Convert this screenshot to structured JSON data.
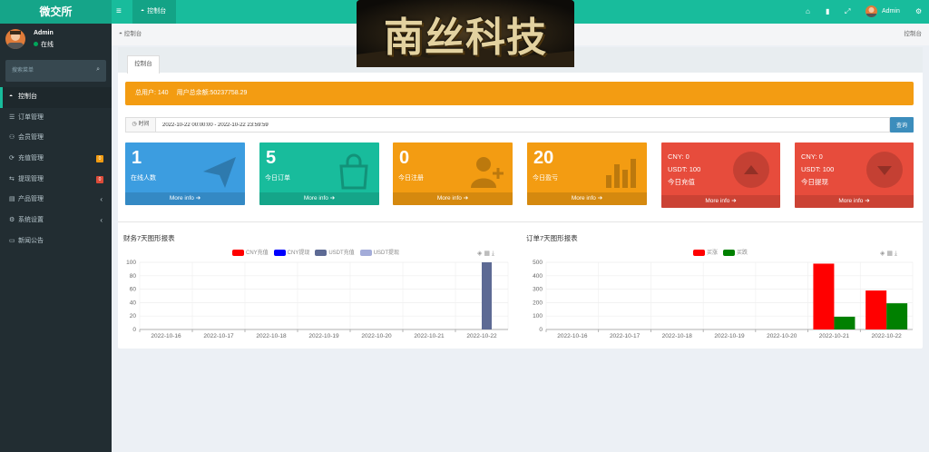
{
  "app": {
    "brand": "微交所",
    "top_tab": "控制台",
    "user": "Admin",
    "logo_text": "南丝科技"
  },
  "sidebar": {
    "name": "Admin",
    "status": "在线",
    "search_placeholder": "搜索菜单",
    "items": [
      {
        "label": "控制台",
        "icon": "dashboard-icon",
        "active": true
      },
      {
        "label": "订单管理",
        "icon": "list-icon"
      },
      {
        "label": "会员管理",
        "icon": "users-icon"
      },
      {
        "label": "充值管理",
        "icon": "recharge-icon",
        "badge": "0",
        "badge_color": "#f39c12"
      },
      {
        "label": "提现管理",
        "icon": "withdraw-icon",
        "badge": "0",
        "badge_color": "#dd4b39"
      },
      {
        "label": "产品管理",
        "icon": "product-icon",
        "arrow": "‹"
      },
      {
        "label": "系统设置",
        "icon": "cogs-icon",
        "arrow": "‹"
      },
      {
        "label": "新闻公告",
        "icon": "news-icon"
      }
    ]
  },
  "breadcrumb": {
    "left": "控制台",
    "right": "控制台"
  },
  "tab": {
    "label": "控制台"
  },
  "alert": {
    "users": "总用户: 140",
    "balance": "用户总余额:50237758.29"
  },
  "date_filter": {
    "label": "时间",
    "value": "2022-10-22 00:00:00 - 2022-10-22 23:59:59",
    "button": "查询"
  },
  "stats": [
    {
      "value": "1",
      "label": "在线人数",
      "footer": "More info ➔",
      "color": "#3c9de0"
    },
    {
      "value": "5",
      "label": "今日订单",
      "footer": "More info ➔",
      "color": "#18bc9c"
    },
    {
      "value": "0",
      "label": "今日注册",
      "footer": "More info ➔",
      "color": "#f39c12"
    },
    {
      "value": "20",
      "label": "今日盈亏",
      "footer": "More info ➔",
      "color": "#f39c12"
    },
    {
      "line1": "CNY:  0",
      "line2": "USDT:  100",
      "label": "今日充值",
      "footer": "More info ➔",
      "color": "#e74c3c"
    },
    {
      "line1": "CNY:  0",
      "line2": "USDT:  100",
      "label": "今日提现",
      "footer": "More info ➔",
      "color": "#e74c3c"
    }
  ],
  "chart_data": [
    {
      "type": "bar",
      "title": "财务7天图形报表",
      "categories": [
        "2022-10-16",
        "2022-10-17",
        "2022-10-18",
        "2022-10-19",
        "2022-10-20",
        "2022-10-21",
        "2022-10-22"
      ],
      "ylim": [
        0,
        100
      ],
      "yticks": [
        0,
        20,
        40,
        60,
        80,
        100
      ],
      "series": [
        {
          "name": "CNY充值",
          "color": "#ff0000",
          "values": [
            0,
            0,
            0,
            0,
            0,
            0,
            0
          ]
        },
        {
          "name": "CNY提现",
          "color": "#0000ff",
          "values": [
            0,
            0,
            0,
            0,
            0,
            0,
            0
          ]
        },
        {
          "name": "USDT充值",
          "color": "#5d6a94",
          "values": [
            0,
            0,
            0,
            0,
            0,
            0,
            100
          ]
        },
        {
          "name": "USDT提现",
          "color": "#a3acd9",
          "values": [
            0,
            0,
            0,
            0,
            0,
            0,
            0
          ]
        }
      ]
    },
    {
      "type": "bar",
      "title": "订单7天图形报表",
      "categories": [
        "2022-10-16",
        "2022-10-17",
        "2022-10-18",
        "2022-10-19",
        "2022-10-20",
        "2022-10-21",
        "2022-10-22"
      ],
      "ylim": [
        0,
        500
      ],
      "yticks": [
        0,
        100,
        200,
        300,
        400,
        500
      ],
      "series": [
        {
          "name": "买涨",
          "color": "#ff0000",
          "values": [
            0,
            0,
            0,
            0,
            0,
            490,
            290
          ]
        },
        {
          "name": "买跌",
          "color": "#008000",
          "values": [
            0,
            0,
            0,
            0,
            0,
            95,
            195
          ]
        }
      ]
    }
  ]
}
